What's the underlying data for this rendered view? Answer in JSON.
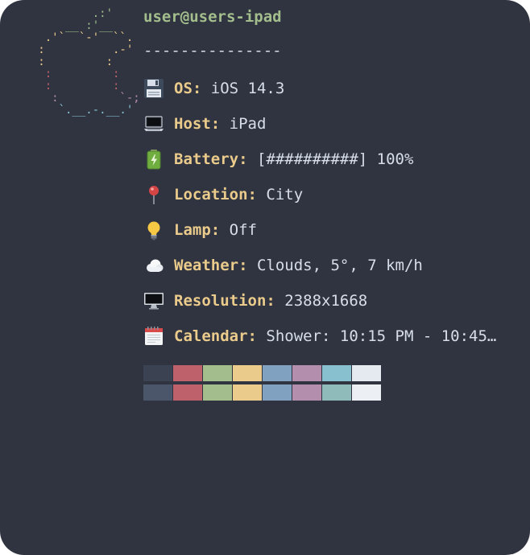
{
  "logo_lines": [
    {
      "text": "           .:'",
      "color": "#a3be8c"
    },
    {
      "text": "       __ :'__",
      "color": "#a3be8c"
    },
    {
      "text": "    .'`  `-'  ``.",
      "color": "#ebcb8b"
    },
    {
      "text": "   :          .-'",
      "color": "#ebcb8b"
    },
    {
      "text": "   :         :",
      "color": "#ebcb8b"
    },
    {
      "text": "    :         :",
      "color": "#bf616a"
    },
    {
      "text": "    :         :",
      "color": "#bf616a"
    },
    {
      "text": "     :         `-;",
      "color": "#b48ead"
    },
    {
      "text": "      `.__.-.__.'",
      "color": "#88c0d0"
    }
  ],
  "header": {
    "user": "user",
    "at": "@",
    "host": "users-ipad",
    "divider": "---------------"
  },
  "rows": [
    {
      "icon": "floppy-icon",
      "key": "OS:",
      "value": " iOS 14.3"
    },
    {
      "icon": "laptop-icon",
      "key": "Host:",
      "value": " iPad"
    },
    {
      "icon": "battery-icon",
      "key": "Battery:",
      "value": " [##########] 100%"
    },
    {
      "icon": "pin-icon",
      "key": "Location:",
      "value": " City"
    },
    {
      "icon": "bulb-icon",
      "key": "Lamp:",
      "value": " Off"
    },
    {
      "icon": "cloud-icon",
      "key": "Weather:",
      "value": " Clouds, 5°, 7 km/h"
    },
    {
      "icon": "monitor-icon",
      "key": "Resolution:",
      "value": " 2388x1668"
    },
    {
      "icon": "calendar-icon",
      "key": "Calendar:",
      "value": " Shower: 10:15 PM - 10:45…"
    }
  ],
  "palette": {
    "row1": [
      "#3b4252",
      "#bf616a",
      "#a3be8c",
      "#ebcb8b",
      "#81a1c1",
      "#b48ead",
      "#88c0d0",
      "#e5e9f0"
    ],
    "row2": [
      "#4c566a",
      "#bf616a",
      "#a3be8c",
      "#ebcb8b",
      "#81a1c1",
      "#b48ead",
      "#8fbcbb",
      "#eceff4"
    ]
  }
}
